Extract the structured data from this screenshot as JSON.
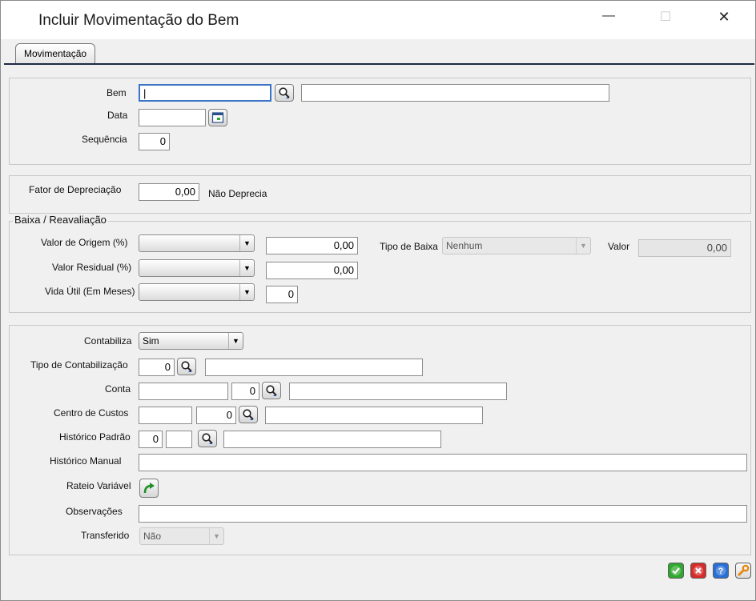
{
  "window": {
    "title": "Incluir Movimentação do Bem",
    "minimize_glyph": "—",
    "maximize_glyph": "☐",
    "close_glyph": "✕"
  },
  "tabs": [
    {
      "label": "Movimentação",
      "active": true
    }
  ],
  "bem_section": {
    "bem_label": "Bem",
    "bem_value": "|",
    "bem_description": "",
    "data_label": "Data",
    "data_value": "",
    "sequencia_label": "Sequência",
    "sequencia_value": "0"
  },
  "depreciacao": {
    "label": "Fator de Depreciação",
    "value": "0,00",
    "status": "Não Deprecia"
  },
  "baixa": {
    "legend": "Baixa / Reavaliação",
    "valor_origem_label": "Valor de Origem (%)",
    "valor_origem_select": "",
    "valor_origem_value": "0,00",
    "valor_residual_label": "Valor Residual (%)",
    "valor_residual_select": "",
    "valor_residual_value": "0,00",
    "vida_util_label": "Vida Útil (Em Meses)",
    "vida_util_select": "",
    "vida_util_value": "0",
    "tipo_baixa_label": "Tipo de Baixa",
    "tipo_baixa_value": "Nenhum",
    "valor_label": "Valor",
    "valor_value": "0,00"
  },
  "contabil": {
    "contabiliza_label": "Contabiliza",
    "contabiliza_value": "Sim",
    "tipo_label": "Tipo de Contabilização",
    "tipo_code": "0",
    "tipo_desc": "",
    "conta_label": "Conta",
    "conta_value": "",
    "conta_code": "0",
    "conta_desc": "",
    "centro_label": "Centro de Custos",
    "centro_value": "",
    "centro_code": "0",
    "centro_desc": "",
    "historico_padrao_label": "Histórico Padrão",
    "historico_code": "0",
    "historico_sub": "",
    "historico_desc": "",
    "historico_manual_label": "Histórico Manual",
    "historico_manual_value": "",
    "rateio_label": "Rateio Variável",
    "observacoes_label": "Observações",
    "observacoes_value": "",
    "transferido_label": "Transferido",
    "transferido_value": "Não"
  },
  "icons": {
    "search": "search-icon",
    "calendar": "calendar-icon",
    "rateio": "green-arrow-icon",
    "ok": "ok-check-icon",
    "cancel": "cancel-x-icon",
    "help": "help-question-icon",
    "tools": "wrench-icon"
  },
  "colors": {
    "ok": "#2fa82f",
    "cancel": "#d62b2b",
    "help": "#2a6fd6",
    "tools": "#e38a14",
    "focus_border": "#3b73c7",
    "tab_line": "#1c2a44"
  }
}
